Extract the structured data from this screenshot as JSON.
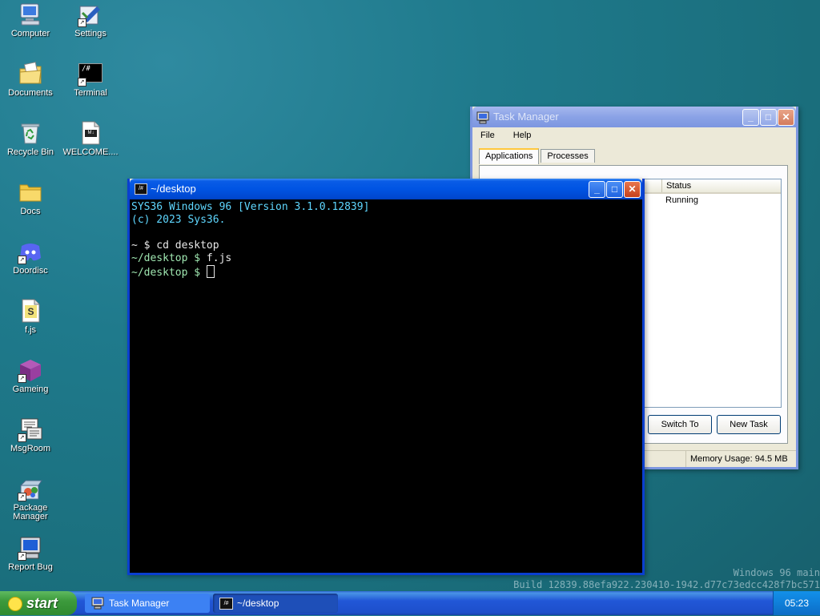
{
  "desktop": {
    "icons": [
      {
        "label": "Computer",
        "icon": "computer-icon"
      },
      {
        "label": "Settings",
        "icon": "settings-icon"
      },
      {
        "label": "Documents",
        "icon": "documents-icon"
      },
      {
        "label": "Terminal",
        "icon": "terminal-icon",
        "glyph": "/#"
      },
      {
        "label": "Recycle Bin",
        "icon": "recycle-bin-icon"
      },
      {
        "label": "WELCOME....",
        "icon": "markdown-file-icon",
        "glyph": "M↓"
      },
      {
        "label": "Docs",
        "icon": "folder-icon"
      },
      {
        "label": "Doordisc",
        "icon": "discord-icon"
      },
      {
        "label": "f.js",
        "icon": "js-file-icon",
        "glyph": "S"
      },
      {
        "label": "Gameing",
        "icon": "cube-icon"
      },
      {
        "label": "MsgRoom",
        "icon": "msgroom-icon"
      },
      {
        "label": "Package Manager",
        "icon": "package-icon"
      },
      {
        "label": "Report Bug",
        "icon": "report-bug-icon"
      }
    ]
  },
  "terminal": {
    "title": "~/desktop",
    "title_glyph": "/#",
    "lines": [
      {
        "text": "SYS36 Windows 96 [Version 3.1.0.12839]"
      },
      {
        "text": "(c) 2023 Sys36."
      },
      {
        "text": ""
      },
      {
        "prompt": "~ $",
        "cmd": " cd desktop"
      },
      {
        "prompt": "~/desktop $",
        "cmd": " f.js"
      },
      {
        "prompt": "~/desktop $",
        "cmd": " "
      }
    ]
  },
  "task_manager": {
    "title": "Task Manager",
    "menu": [
      "File",
      "Help"
    ],
    "tabs": [
      "Applications",
      "Processes"
    ],
    "columns": {
      "status": "Status"
    },
    "rows": [
      {
        "status": "Running"
      }
    ],
    "switch_button": "Switch To",
    "new_task_button": "New Task",
    "memory_usage": "Memory Usage: 94.5 MB"
  },
  "watermark": {
    "line1": "Windows 96 main",
    "line2": "Build 12839.88efa922.230410-1942.d77c73edcc428f7bc571"
  },
  "taskbar": {
    "start_label": "start",
    "tasks": [
      {
        "label": "Task Manager"
      },
      {
        "label": "~/desktop",
        "glyph": "/#"
      }
    ],
    "clock": "05:23"
  },
  "colors": {
    "desktop_bg": "#1f7a8c",
    "titlebar_active": "#0054e3",
    "terminal_text_cyan": "#5fd7ff",
    "terminal_prompt_green": "#9fe6b0",
    "taskbar": "#245edb",
    "start_button": "#3c9a3c"
  }
}
